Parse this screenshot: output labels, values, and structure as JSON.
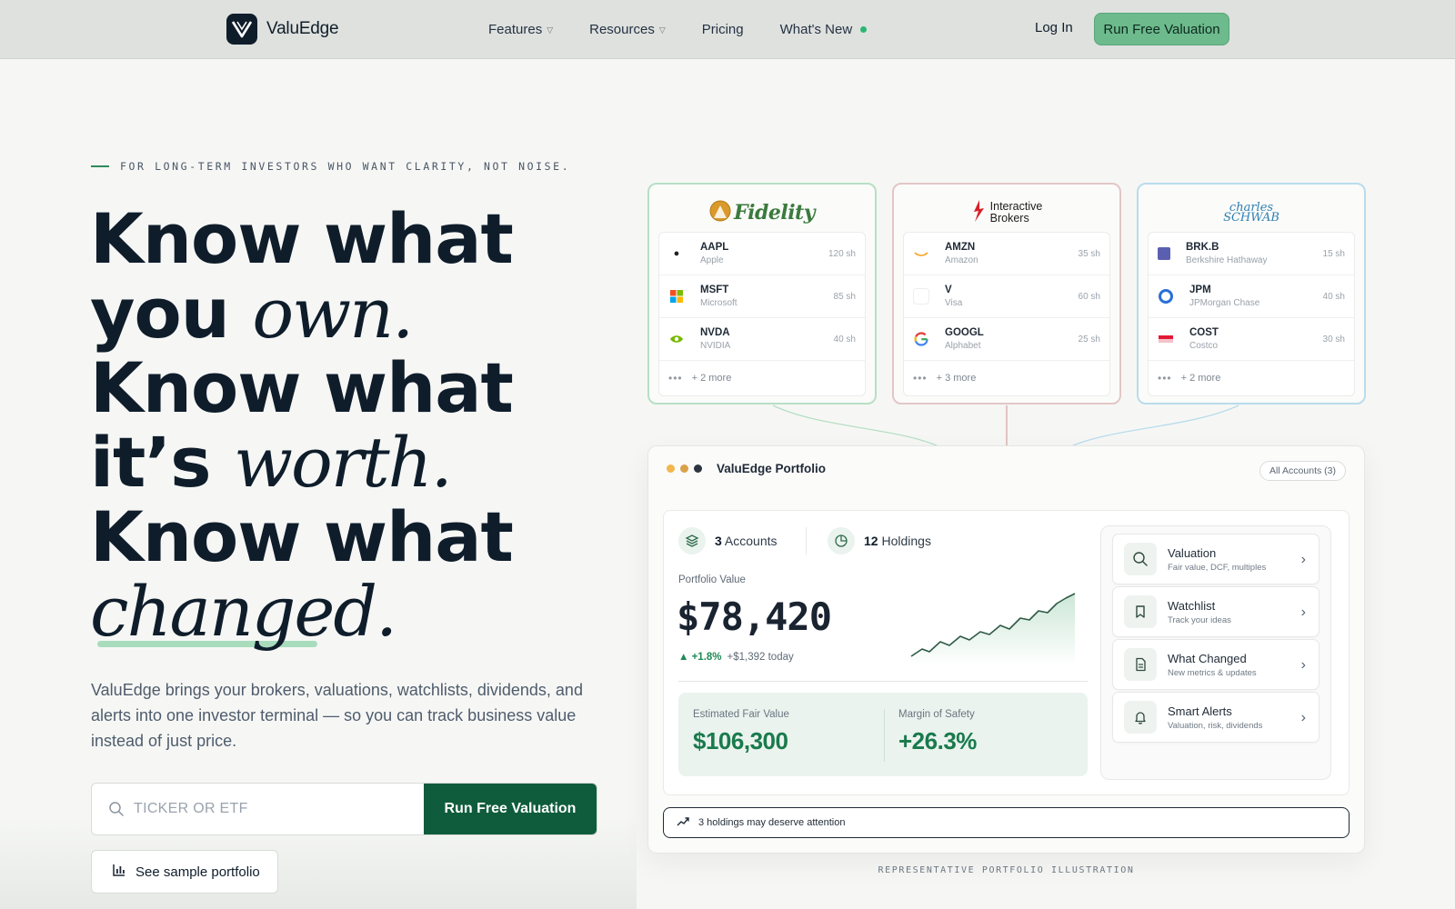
{
  "nav": {
    "brand": "ValuEdge",
    "links": [
      {
        "label": "Features",
        "has_menu": true
      },
      {
        "label": "Resources",
        "has_menu": true
      },
      {
        "label": "Pricing",
        "has_menu": false
      },
      {
        "label": "What's New",
        "has_menu": false
      }
    ],
    "login": "Log In",
    "cta": "Run Free Valuation"
  },
  "hero": {
    "eyebrow": "FOR LONG-TERM INVESTORS WHO WANT CLARITY, NOT NOISE.",
    "headline": {
      "l1": "Know what",
      "l2a": "you ",
      "l2b": "own.",
      "l3": "Know what",
      "l4a": "it’s ",
      "l4b": "worth.",
      "l5": "Know what",
      "l6": "changed."
    },
    "subtext": "ValuEdge brings your brokers, valuations, watchlists, dividends, and alerts into one investor terminal — so you can track business value instead of just price.",
    "search_placeholder": "TICKER OR ETF",
    "search_button": "Run Free Valuation",
    "sample_button": "See sample portfolio"
  },
  "brokers": [
    {
      "name": "Fidelity",
      "holdings": [
        {
          "ticker": "AAPL",
          "name": "Apple",
          "shares": "120 sh"
        },
        {
          "ticker": "MSFT",
          "name": "Microsoft",
          "shares": "85 sh"
        },
        {
          "ticker": "NVDA",
          "name": "NVIDIA",
          "shares": "40 sh"
        }
      ],
      "more": "+ 2 more"
    },
    {
      "name_l1": "Interactive",
      "name_l2": "Brokers",
      "holdings": [
        {
          "ticker": "AMZN",
          "name": "Amazon",
          "shares": "35 sh"
        },
        {
          "ticker": "V",
          "name": "Visa",
          "shares": "60 sh"
        },
        {
          "ticker": "GOOGL",
          "name": "Alphabet",
          "shares": "25 sh"
        }
      ],
      "more": "+ 3 more"
    },
    {
      "name_l1": "charles",
      "name_l2": "SCHWAB",
      "holdings": [
        {
          "ticker": "BRK.B",
          "name": "Berkshire Hathaway",
          "shares": "15 sh"
        },
        {
          "ticker": "JPM",
          "name": "JPMorgan Chase",
          "shares": "40 sh"
        },
        {
          "ticker": "COST",
          "name": "Costco",
          "shares": "30 sh"
        }
      ],
      "more": "+ 2 more"
    }
  ],
  "portfolio": {
    "title": "ValuEdge Portfolio",
    "accounts_chip": "All Accounts (3)",
    "accounts_count": "3",
    "accounts_label": "Accounts",
    "holdings_count": "12",
    "holdings_label": "Holdings",
    "value_label": "Portfolio Value",
    "value": "$78,420",
    "change_pct": "▲ +1.8%",
    "change_abs": "+$1,392 today",
    "fair_value_label": "Estimated Fair Value",
    "fair_value": "$106,300",
    "margin_label": "Margin of Safety",
    "margin": "+26.3%",
    "menu": [
      {
        "title": "Valuation",
        "sub": "Fair value, DCF, multiples"
      },
      {
        "title": "Watchlist",
        "sub": "Track your ideas"
      },
      {
        "title": "What Changed",
        "sub": "New metrics & updates"
      },
      {
        "title": "Smart Alerts",
        "sub": "Valuation, risk, dividends"
      }
    ],
    "attention": "3 holdings may deserve attention"
  },
  "caption": "REPRESENTATIVE PORTFOLIO ILLUSTRATION",
  "colors": {
    "accent": "#0f5c3c",
    "accent_light": "#6dba8d",
    "ink": "#0f1d2b",
    "positive": "#1a7a4c"
  }
}
